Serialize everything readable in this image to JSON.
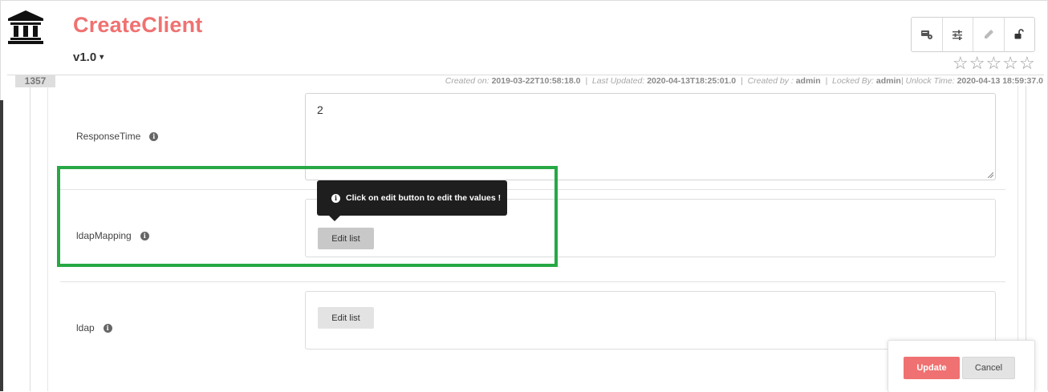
{
  "header": {
    "title": "CreateClient",
    "version": "v1.0",
    "version_caret": "▾",
    "logo_icon": "bank-icon",
    "rating_stars": [
      "☆",
      "☆",
      "☆",
      "☆",
      "☆"
    ],
    "rating_value": 0,
    "toolbar_icons": [
      "tag-settings-icon",
      "sliders-icon",
      "pencil-icon",
      "unlock-icon"
    ]
  },
  "meta": {
    "id": "1357",
    "created_on_label": "Created on:",
    "created_on": "2019-03-22T10:58:18.0",
    "last_updated_label": "Last Updated:",
    "last_updated": "2020-04-13T18:25:01.0",
    "created_by_label": "Created by :",
    "created_by": "admin",
    "locked_by_label": "Locked By:",
    "locked_by": "admin",
    "unlock_time_label": "Unlock Time:",
    "unlock_time": "2020-04-13 18:59:37.0",
    "separator": "|"
  },
  "fields": {
    "response_time": {
      "label": "ResponseTime",
      "value": "2"
    },
    "ldap_mapping": {
      "label": "ldapMapping",
      "button": "Edit list"
    },
    "ldap": {
      "label": "ldap",
      "button": "Edit list"
    }
  },
  "tooltip": {
    "text": "Click on edit button to edit the values !"
  },
  "actions": {
    "update": "Update",
    "cancel": "Cancel"
  },
  "colors": {
    "title": "#f07171",
    "update_button": "#f07171",
    "highlight": "#27a844",
    "tooltip_bg": "#1e1e1e"
  }
}
